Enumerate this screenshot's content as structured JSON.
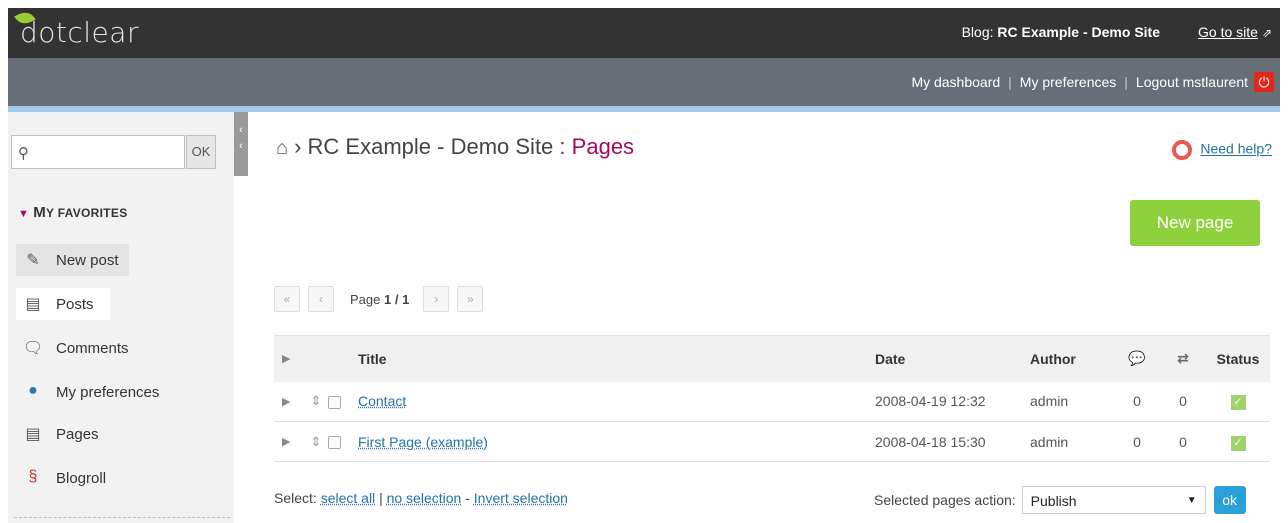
{
  "header": {
    "logo": "dotclear",
    "blog_prefix": "Blog:",
    "blog_name": "RC Example - Demo Site",
    "go_to_site": "Go to site"
  },
  "subnav": {
    "dashboard": "My dashboard",
    "preferences": "My preferences",
    "logout": "Logout mstlaurent"
  },
  "sidebar": {
    "search_placeholder": "",
    "ok_label": "OK",
    "favorites_first": "M",
    "favorites_rest": "Y FAVORITES",
    "items": [
      {
        "label": "New post",
        "icon": "new-post-icon"
      },
      {
        "label": "Posts",
        "icon": "posts-icon"
      },
      {
        "label": "Comments",
        "icon": "comments-icon"
      },
      {
        "label": "My preferences",
        "icon": "user-prefs-icon"
      },
      {
        "label": "Pages",
        "icon": "pages-icon"
      },
      {
        "label": "Blogroll",
        "icon": "blogroll-icon"
      }
    ]
  },
  "main": {
    "breadcrumb_site": "RC Example - Demo Site",
    "breadcrumb_sep": ":",
    "breadcrumb_page": "Pages",
    "help": "Need help?",
    "new_page": "New page",
    "pager": {
      "prefix": "Page",
      "current": "1 / 1"
    },
    "table": {
      "headers": {
        "title": "Title",
        "date": "Date",
        "author": "Author",
        "status": "Status"
      },
      "rows": [
        {
          "title": "Contact",
          "date": "2008-04-19 12:32",
          "author": "admin",
          "comments": "0",
          "trackbacks": "0"
        },
        {
          "title": "First Page (example)",
          "date": "2008-04-18 15:30",
          "author": "admin",
          "comments": "0",
          "trackbacks": "0"
        }
      ]
    },
    "select": {
      "label": "Select:",
      "all": "select all",
      "sep": "|",
      "none": "no selection",
      "dash": "-",
      "invert": "Invert selection"
    },
    "action": {
      "label": "Selected pages action:",
      "value": "Publish",
      "ok": "ok"
    }
  },
  "colors": {
    "topbar": "#333333",
    "subbar": "#676e78",
    "accent": "#a6085e",
    "link": "#2373a5",
    "new_button": "#8ed13c",
    "ok_button": "#2aa0d9"
  }
}
